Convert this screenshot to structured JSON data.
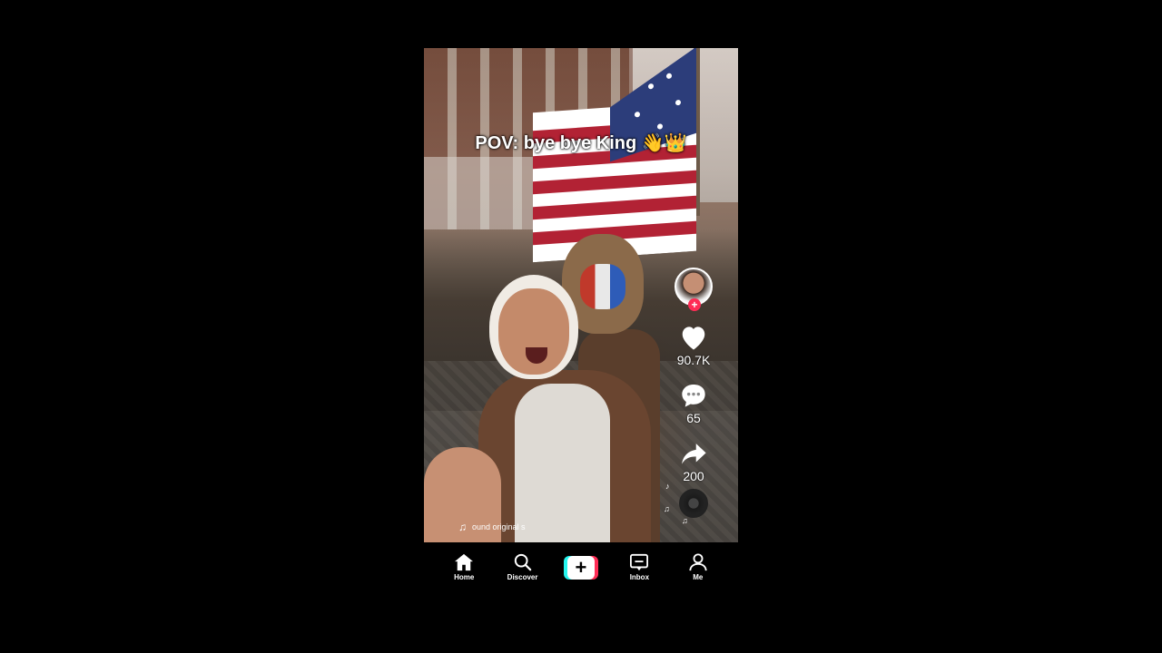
{
  "caption": "POV: bye bye King 👋👑",
  "actions": {
    "likes": "90.7K",
    "comments": "65",
    "shares": "200",
    "follow_symbol": "+"
  },
  "sound": {
    "icon": "♫",
    "text": "ound original s"
  },
  "tabs": [
    {
      "label": "Home",
      "icon": "home-icon"
    },
    {
      "label": "Discover",
      "icon": "search-icon"
    },
    {
      "label": "",
      "icon": "create-icon",
      "symbol": "+"
    },
    {
      "label": "Inbox",
      "icon": "inbox-icon"
    },
    {
      "label": "Me",
      "icon": "profile-icon"
    }
  ],
  "colors": {
    "accent_red": "#fe2c55",
    "accent_cyan": "#25f4ee",
    "background": "#000000"
  }
}
